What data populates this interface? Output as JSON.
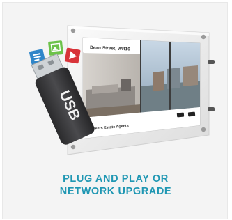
{
  "colors": {
    "accent": "#1f97b3",
    "card_background": "#f4f4f4",
    "usb_body": "#3a3a3c",
    "icon_blue": "#2f86c9",
    "icon_green": "#6cc24a",
    "icon_red": "#d8343a"
  },
  "illustration": {
    "usb_label": "USB",
    "display": {
      "address": "Dean Street, WR10",
      "agent": "Parkers Estate Agents"
    },
    "icons": [
      "document-icon",
      "image-icon",
      "video-icon"
    ]
  },
  "caption": {
    "line1": "PLUG AND PLAY OR",
    "line2": "NETWORK UPGRADE"
  }
}
